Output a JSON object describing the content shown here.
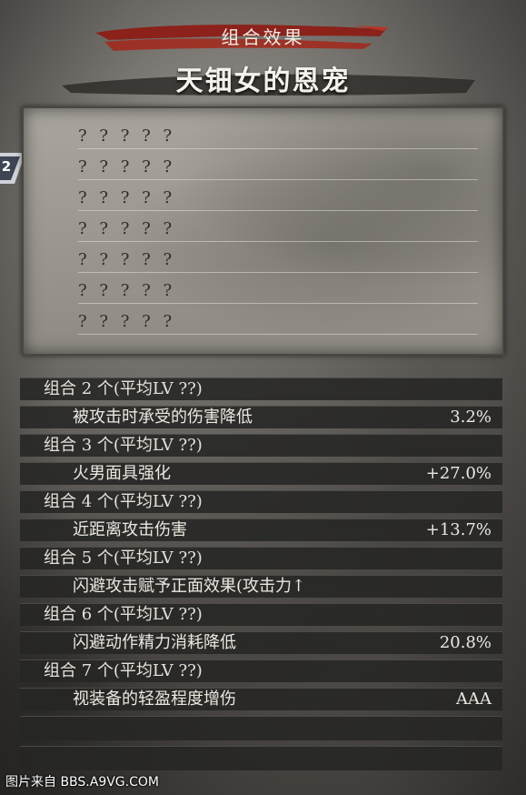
{
  "header": {
    "label": "组合效果",
    "title": "天钿女的恩宠"
  },
  "side_tab": {
    "number": "2"
  },
  "slots": [
    "? ? ? ? ?",
    "? ? ? ? ?",
    "? ? ? ? ?",
    "? ? ? ? ?",
    "? ? ? ? ?",
    "? ? ? ? ?",
    "? ? ? ? ?"
  ],
  "effects": [
    {
      "group": "组合 2 个(平均LV  ??)",
      "label": "被攻击时承受的伤害降低",
      "value": "3.2%"
    },
    {
      "group": "组合 3 个(平均LV  ??)",
      "label": "火男面具强化",
      "value": "+27.0%"
    },
    {
      "group": "组合 4 个(平均LV  ??)",
      "label": "近距离攻击伤害",
      "value": "+13.7%"
    },
    {
      "group": "组合 5 个(平均LV  ??)",
      "label": "闪避攻击赋予正面效果(攻击力↑",
      "value": ""
    },
    {
      "group": "组合 6 个(平均LV  ??)",
      "label": "闪避动作精力消耗降低",
      "value": "20.8%"
    },
    {
      "group": "组合 7 个(平均LV  ??)",
      "label": "视装备的轻盈程度增伤",
      "value": "AAA"
    }
  ],
  "watermark": "图片来自 BBS.A9VG.COM",
  "colors": {
    "brush_red": "#9a1a12",
    "row_bg": "#262524",
    "parchment": "#9c9891"
  }
}
